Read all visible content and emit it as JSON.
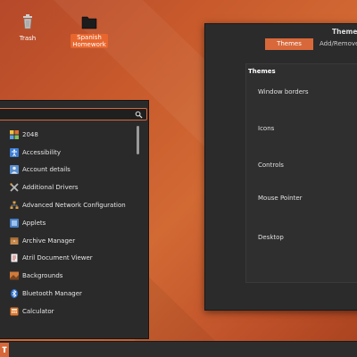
{
  "desktop": {
    "icons": [
      {
        "label": "Trash",
        "icon": "trash-icon"
      },
      {
        "label": "Spanish\nHomework",
        "icon": "folder-icon"
      }
    ]
  },
  "appearance_window": {
    "title": "Themes",
    "tabs": [
      {
        "label": "Themes",
        "active": true
      },
      {
        "label": "Add/Remove",
        "active": false
      }
    ],
    "section_title": "Themes",
    "rows": [
      "Window borders",
      "Icons",
      "Controls",
      "Mouse Pointer",
      "Desktop"
    ]
  },
  "app_menu": {
    "search": {
      "value": "",
      "placeholder": ""
    },
    "apps": [
      {
        "label": "2048",
        "icon": "game-2048-icon"
      },
      {
        "label": "Accessibility",
        "icon": "accessibility-icon"
      },
      {
        "label": "Account details",
        "icon": "account-icon"
      },
      {
        "label": "Additional Drivers",
        "icon": "drivers-icon"
      },
      {
        "label": "Advanced Network Configuration",
        "icon": "network-icon"
      },
      {
        "label": "Applets",
        "icon": "applets-icon"
      },
      {
        "label": "Archive Manager",
        "icon": "archive-icon"
      },
      {
        "label": "Atril Document Viewer",
        "icon": "document-viewer-icon"
      },
      {
        "label": "Backgrounds",
        "icon": "backgrounds-icon"
      },
      {
        "label": "Bluetooth Manager",
        "icon": "bluetooth-icon"
      },
      {
        "label": "Calculator",
        "icon": "calculator-icon"
      }
    ]
  },
  "colors": {
    "accent": "#d8683a",
    "window_bg": "#2b2b2b",
    "menu_bg": "#2a2a2a"
  }
}
